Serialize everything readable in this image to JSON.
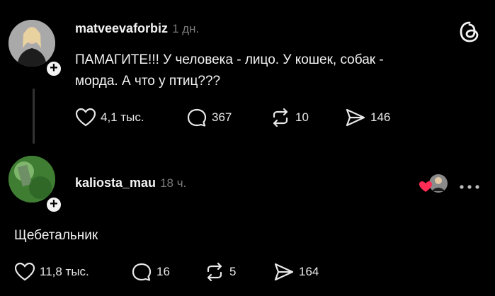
{
  "post": {
    "username": "matveevaforbiz",
    "time": "1 дн.",
    "text_line1": "ПАМАГИТЕ!!! У человека - лицо. У кошек, собак -",
    "text_line2": "морда. А что у птиц???",
    "likes": "4,1 тыс.",
    "replies": "367",
    "reposts": "10",
    "shares": "146"
  },
  "reply": {
    "username": "kaliosta_mau",
    "time": "18 ч.",
    "text": "Щебетальник",
    "likes": "11,8 тыс.",
    "replies": "16",
    "reposts": "5",
    "shares": "164"
  },
  "icons": {
    "app": "threads-logo-icon",
    "like": "heart-icon",
    "reply": "comment-bubble-icon",
    "repost": "repost-icon",
    "share": "send-icon",
    "more": "more-dots-icon",
    "liked_by_author": "heart-red-icon"
  },
  "colors": {
    "background": "#000000",
    "text": "#f3f3f3",
    "muted": "#7b7b7b",
    "like_red": "#ff2d55"
  }
}
